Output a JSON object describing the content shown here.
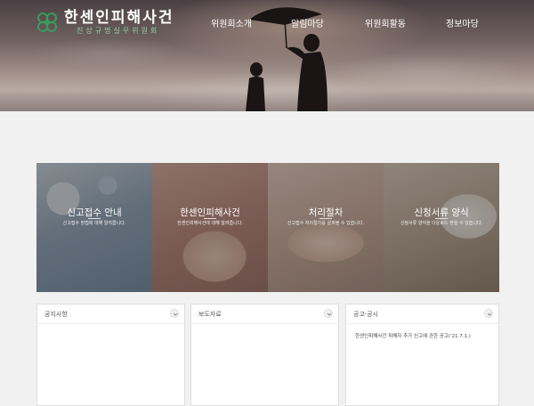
{
  "header": {
    "logo_title": "한센인피해사건",
    "logo_subtitle": "진상규명실무위원회",
    "logo_icon": "clover-emblem-icon",
    "accent_color": "#3a9b5a"
  },
  "nav": {
    "items": [
      {
        "label": "위원회소개"
      },
      {
        "label": "알림마당"
      },
      {
        "label": "위원회활동"
      },
      {
        "label": "정보마당"
      }
    ]
  },
  "tiles": [
    {
      "title": "신고접수 안내",
      "desc": "신고접수 방법에 대해 알려줍니다."
    },
    {
      "title": "한센인피해사건",
      "desc": "한센인피해사건에 대해 알려줍니다."
    },
    {
      "title": "처리절차",
      "desc": "신고접수 처리절차를 살펴볼 수 있습니다."
    },
    {
      "title": "신청서류 양식",
      "desc": "신청서류 양식을 다운로드 받을 수 있습니다."
    }
  ],
  "boards": [
    {
      "title": "공지사항",
      "items": []
    },
    {
      "title": "보도자료",
      "items": []
    },
    {
      "title": "공고·공시",
      "items": [
        "한센인피해사건 피해자 추가 신고에 관한 공고('21.7.1.)"
      ]
    }
  ]
}
